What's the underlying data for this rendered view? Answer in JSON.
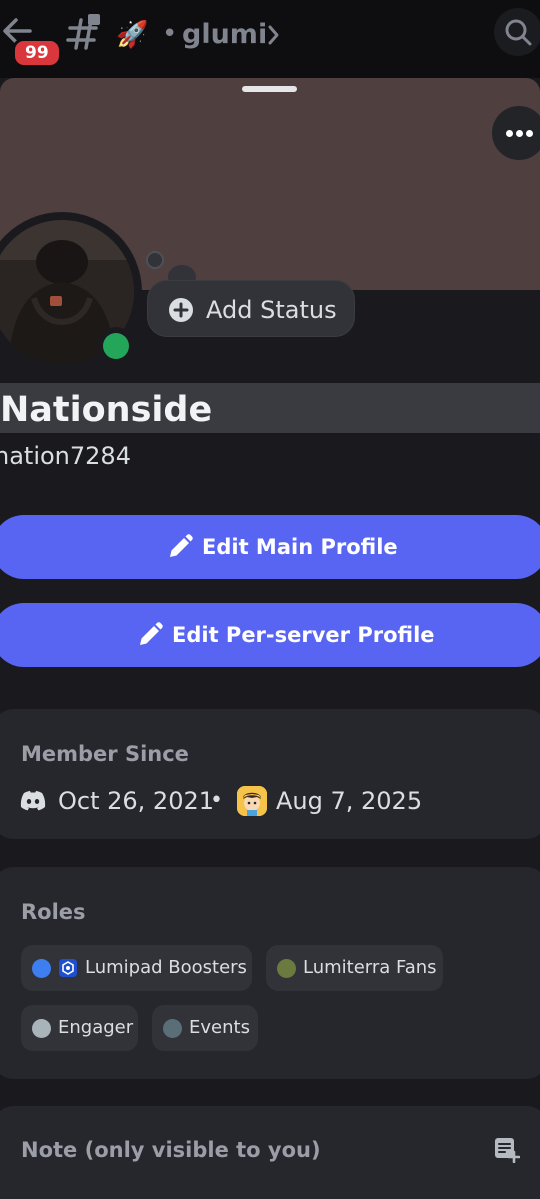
{
  "topbar": {
    "unread_badge": "99",
    "channel_emoji": "🚀",
    "channel_separator": "•",
    "channel_name": "glumi"
  },
  "profile": {
    "add_status_label": "Add Status",
    "display_name": "Nationside",
    "username": "nation7284",
    "status": "online",
    "status_color": "#23a55a",
    "banner_color": "#4f3f3e"
  },
  "actions": {
    "edit_main_label": "Edit Main Profile",
    "edit_server_label": "Edit Per-server Profile",
    "accent_color": "#5865f2"
  },
  "member_since": {
    "title": "Member Since",
    "discord_date": "Oct 26, 2021",
    "separator": "•",
    "server_date": "Aug 7, 2025"
  },
  "roles": {
    "title": "Roles",
    "items": [
      {
        "label": "Lumipad Boosters",
        "color": "#3d7ff0"
      },
      {
        "label": "Lumiterra Fans",
        "color": "#6b7a3e"
      },
      {
        "label": "Engager",
        "color": "#a9b3ba"
      },
      {
        "label": "Events",
        "color": "#5a6e78"
      }
    ]
  },
  "note": {
    "title": "Note (only visible to you)"
  }
}
